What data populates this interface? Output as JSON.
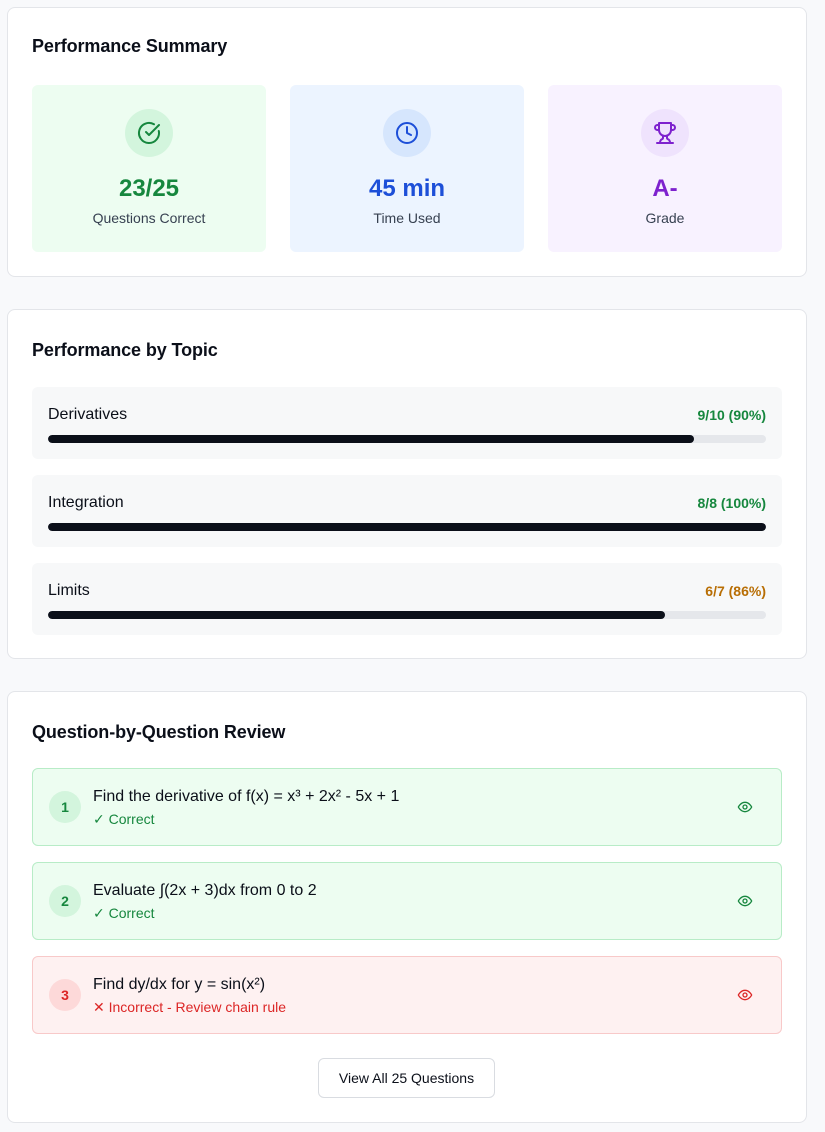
{
  "summary": {
    "title": "Performance Summary",
    "stats": [
      {
        "value": "23/25",
        "label": "Questions Correct",
        "icon": "check-circle-icon",
        "color": "#16873e"
      },
      {
        "value": "45 min",
        "label": "Time Used",
        "icon": "clock-icon",
        "color": "#1d4fd8"
      },
      {
        "value": "A-",
        "label": "Grade",
        "icon": "trophy-icon",
        "color": "#7e22ce"
      }
    ]
  },
  "topics": {
    "title": "Performance by Topic",
    "items": [
      {
        "name": "Derivatives",
        "score": "9/10 (90%)",
        "progress": 0.9,
        "score_color": "#16873e"
      },
      {
        "name": "Integration",
        "score": "8/8 (100%)",
        "progress": 1.0,
        "score_color": "#16873e"
      },
      {
        "name": "Limits",
        "score": "6/7 (86%)",
        "progress": 0.86,
        "score_color": "#b86e04"
      }
    ]
  },
  "review": {
    "title": "Question-by-Question Review",
    "questions": [
      {
        "number": "1",
        "text": "Find the derivative of f(x) = x³ + 2x² - 5x + 1",
        "status": "✓ Correct",
        "result": "correct",
        "icon": "eye-icon"
      },
      {
        "number": "2",
        "text": "Evaluate ∫(2x + 3)dx from 0 to 2",
        "status": "✓ Correct",
        "result": "correct",
        "icon": "eye-icon"
      },
      {
        "number": "3",
        "text": "Find dy/dx for y = sin(x²)",
        "status": "✕ Incorrect - Review chain rule",
        "result": "incorrect",
        "icon": "eye-icon"
      }
    ],
    "view_all_label": "View All 25 Questions"
  }
}
